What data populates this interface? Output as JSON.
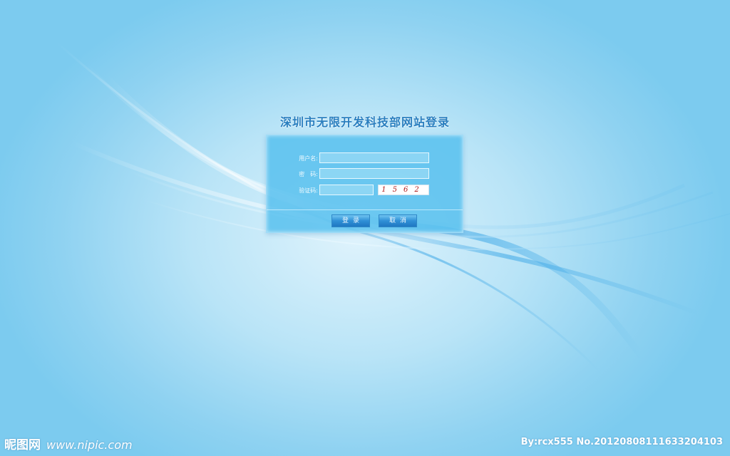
{
  "login": {
    "title": "深圳市无限开发科技部网站登录",
    "username_label": "用户名:",
    "password_label": "密　码:",
    "captcha_label": "验证码:",
    "username_value": "",
    "password_value": "",
    "captcha_value": "",
    "captcha_code": "1562",
    "login_button": "登录",
    "cancel_button": "取消"
  },
  "watermark": {
    "site_name": "昵图网",
    "site_url": "www.nipic.com",
    "author_id": "By:rcx555 No.20120808111633204103"
  },
  "colors": {
    "panel": "#53beee",
    "title": "#2a7fbf",
    "button": "#2f8fd6",
    "captcha_text": "#b01818"
  }
}
